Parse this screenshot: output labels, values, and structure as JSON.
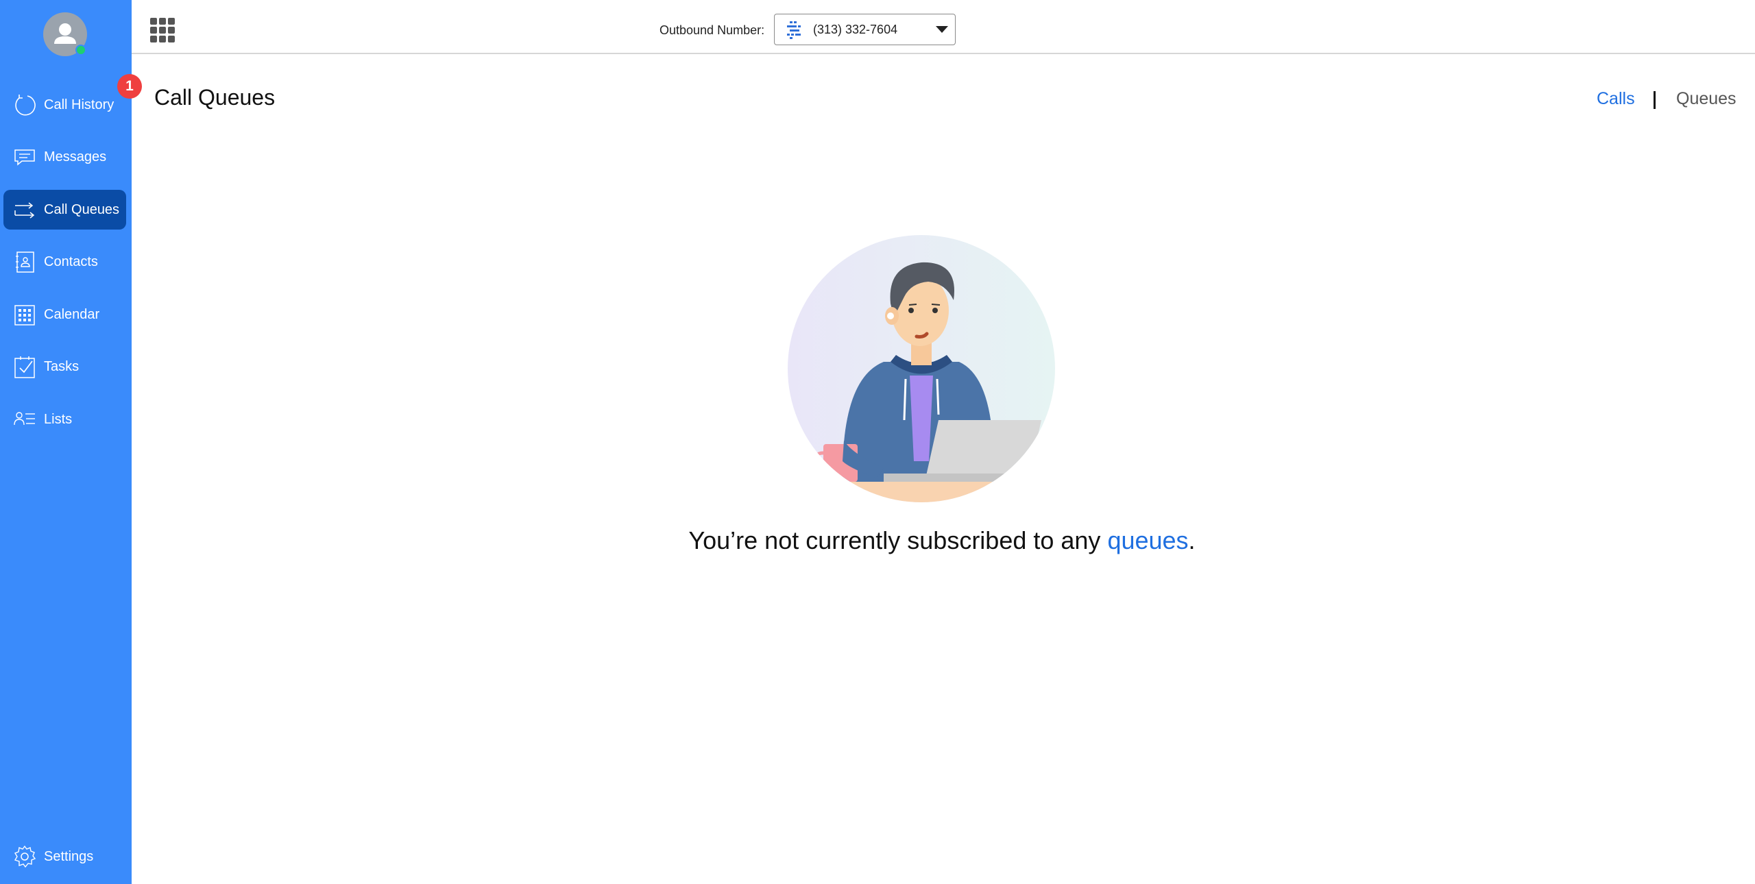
{
  "sidebar": {
    "badge_count": "1",
    "items": [
      {
        "label": "Call History",
        "icon": "refresh-icon"
      },
      {
        "label": "Messages",
        "icon": "chat-icon"
      },
      {
        "label": "Call Queues",
        "icon": "queue-arrows-icon",
        "active": true
      },
      {
        "label": "Contacts",
        "icon": "contact-card-icon"
      },
      {
        "label": "Calendar",
        "icon": "calendar-icon"
      },
      {
        "label": "Tasks",
        "icon": "checkbox-icon"
      },
      {
        "label": "Lists",
        "icon": "list-people-icon"
      }
    ],
    "settings_label": "Settings"
  },
  "topbar": {
    "outbound_label": "Outbound Number:",
    "outbound_number": "(313) 332-7604"
  },
  "main": {
    "title": "Call Queues",
    "tabs": [
      {
        "label": "Calls",
        "active": true
      },
      {
        "label": "Queues",
        "active": false
      }
    ],
    "empty_message_prefix": "You’re not currently subscribed to any ",
    "empty_message_link": "queues",
    "empty_message_suffix": "."
  },
  "colors": {
    "sidebar": "#3a8bfb",
    "sidebar_active": "#0a4ca6",
    "accent": "#1f6fe0",
    "badge": "#ef3f3f",
    "presence": "#1fcf71"
  }
}
